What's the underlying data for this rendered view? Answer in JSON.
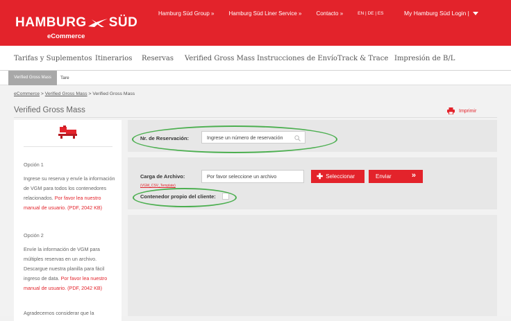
{
  "header": {
    "logo_text_left": "HAMBURG",
    "logo_text_right": "SÜD",
    "logo_sub": "eCommerce",
    "links": [
      "Hamburg Süd Group »",
      "Hamburg Süd Liner Service »",
      "Contacto »"
    ],
    "languages": "EN | DE | ES",
    "login": "My Hamburg Süd Login |",
    "brand_color": "#e3232b"
  },
  "nav": {
    "items": [
      "Tarifas y Suplementos",
      "Itinerarios",
      "Reservas",
      "Verified Gross Mass",
      "Instrucciones de Envío",
      "Track & Trace",
      "Impresión de B/L"
    ]
  },
  "subnav": {
    "active": "Verified Gross Mass",
    "other": "Tare"
  },
  "breadcrumb": {
    "home": "eCommerce",
    "sep1": " > ",
    "section": "Verified Gross Mass",
    "sep2": " > Verified Gross Mass"
  },
  "page": {
    "title": "Verified Gross Mass",
    "print_label": "Imprimir"
  },
  "sidebar": {
    "icon": "scale-container-icon",
    "option1_title": "Opción 1",
    "option1_text": "Ingrese su reserva y envíe la información de VGM para todos los contenedores relacionados.",
    "option1_link": "Por favor lea nuestro manual de usuario. (PDF, 2042 KB)",
    "option2_title": "Opción 2",
    "option2_text": "Envíe la información de VGM para múltiples reservas en un archivo. Descargue nuestra planilla para fácil ingreso de data.",
    "option2_link": "Por favor lea nuestro manual de usuario. (PDF, 2042 KB)",
    "footer_text": "Agradecemos considerar que la"
  },
  "booking": {
    "label": "Nr. de Reservación:",
    "placeholder": "Ingrese un número de reservación"
  },
  "upload": {
    "label": "Carga de Archivo:",
    "template_link": "(VGM_CSV_Template)",
    "placeholder": "Por favor seleccione un archivo",
    "select_button": "Seleccionar",
    "send_button": "Enviar",
    "own_container_label": "Contenedor propio del cliente:"
  }
}
